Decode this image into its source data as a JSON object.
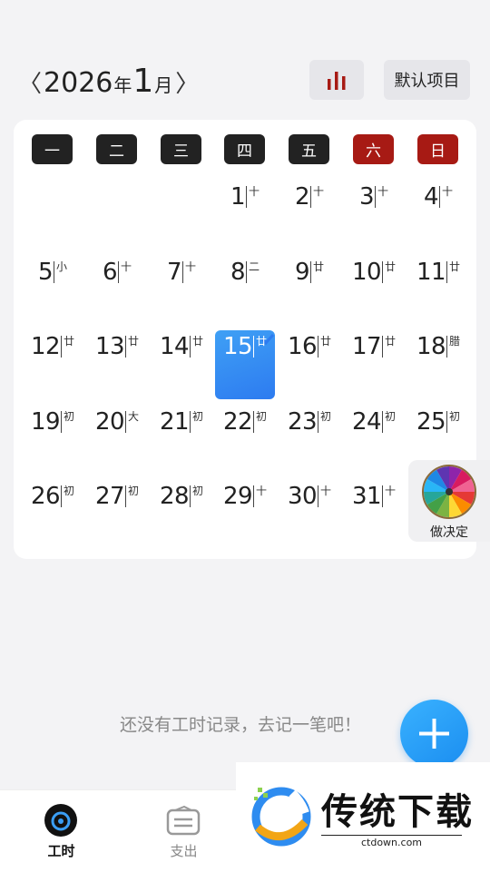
{
  "header": {
    "prev_icon": "chevron-left-icon",
    "year": "2026",
    "year_unit": "年",
    "month": "1",
    "month_unit": "月",
    "next_icon": "chevron-right-icon",
    "stats_icon": "bar-chart-icon",
    "project_label": "默认项目"
  },
  "weekdays": [
    "一",
    "二",
    "三",
    "四",
    "五",
    "六",
    "日"
  ],
  "weekend_color": "#a71a14",
  "days": [
    {
      "num": "1",
      "lunar": "十三"
    },
    {
      "num": "2",
      "lunar": "十四"
    },
    {
      "num": "3",
      "lunar": "十五"
    },
    {
      "num": "4",
      "lunar": "十六"
    },
    {
      "num": "5",
      "lunar": "小寒"
    },
    {
      "num": "6",
      "lunar": "十八"
    },
    {
      "num": "7",
      "lunar": "十九"
    },
    {
      "num": "8",
      "lunar": "二十"
    },
    {
      "num": "9",
      "lunar": "廿一"
    },
    {
      "num": "10",
      "lunar": "廿二"
    },
    {
      "num": "11",
      "lunar": "廿三"
    },
    {
      "num": "12",
      "lunar": "廿四"
    },
    {
      "num": "13",
      "lunar": "廿五"
    },
    {
      "num": "14",
      "lunar": "廿六"
    },
    {
      "num": "15",
      "lunar": "廿七"
    },
    {
      "num": "16",
      "lunar": "廿八"
    },
    {
      "num": "17",
      "lunar": "廿九"
    },
    {
      "num": "18",
      "lunar": "腊月"
    },
    {
      "num": "19",
      "lunar": "初二"
    },
    {
      "num": "20",
      "lunar": "大寒"
    },
    {
      "num": "21",
      "lunar": "初三"
    },
    {
      "num": "22",
      "lunar": "初四"
    },
    {
      "num": "23",
      "lunar": "初五"
    },
    {
      "num": "24",
      "lunar": "初六"
    },
    {
      "num": "25",
      "lunar": "初七"
    },
    {
      "num": "26",
      "lunar": "初八"
    },
    {
      "num": "27",
      "lunar": "初九"
    },
    {
      "num": "28",
      "lunar": "初十"
    },
    {
      "num": "29",
      "lunar": "十一"
    },
    {
      "num": "30",
      "lunar": "十二"
    },
    {
      "num": "31",
      "lunar": "十三"
    }
  ],
  "today": "15",
  "wheel": {
    "label": "做决定",
    "icon": "color-wheel-icon"
  },
  "empty_message": "还没有工时记录，去记一笔吧！",
  "fab_icon": "plus-icon",
  "tabs": [
    {
      "label": "工时",
      "icon": "clock-icon",
      "active": true
    },
    {
      "label": "支出",
      "icon": "wallet-icon",
      "active": false
    }
  ],
  "watermark": {
    "title": "传统下载",
    "url": "ctdown.com"
  },
  "colors": {
    "accent": "#2d8ef2",
    "active_tab": "#111111",
    "inactive_tab": "#888888"
  }
}
